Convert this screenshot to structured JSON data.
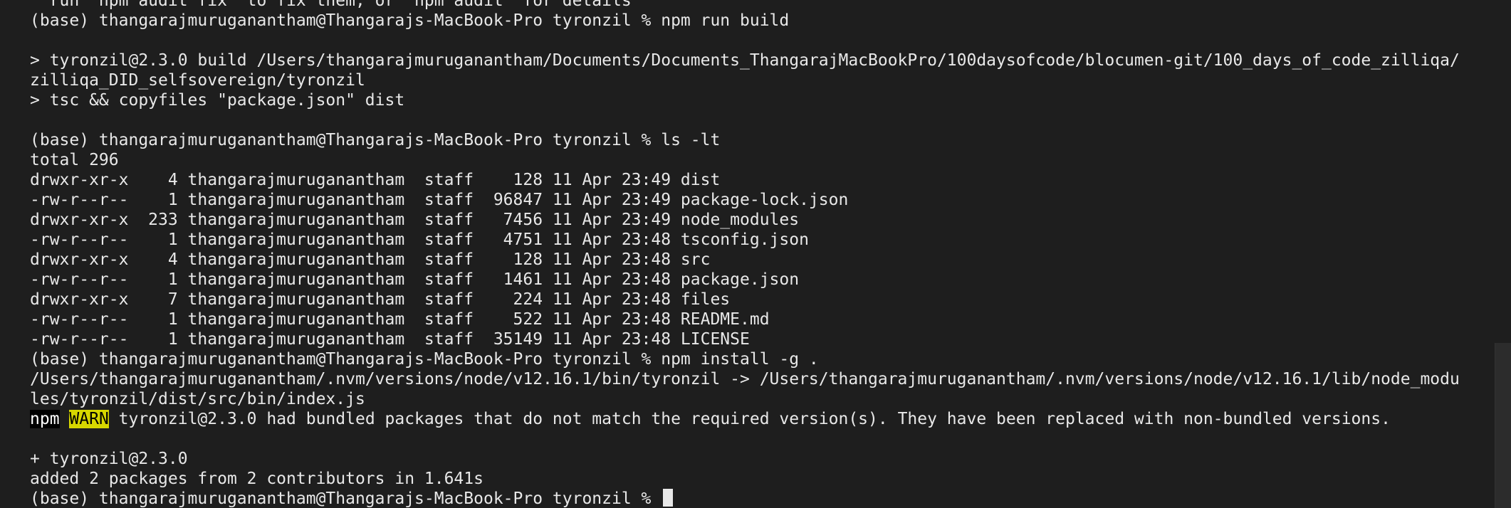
{
  "terminal": {
    "lines": [
      "  run `npm audit fix` to fix them, or `npm audit` for details",
      "(base) thangarajmuruganantham@Thangarajs-MacBook-Pro tyronzil % npm run build",
      "",
      "> tyronzil@2.3.0 build /Users/thangarajmuruganantham/Documents/Documents_ThangarajMacBookPro/100daysofcode/blocumen-git/100_days_of_code_zilliqa/",
      "zilliqa_DID_selfsovereign/tyronzil",
      "> tsc && copyfiles \"package.json\" dist",
      "",
      "(base) thangarajmuruganantham@Thangarajs-MacBook-Pro tyronzil % ls -lt",
      "total 296",
      "drwxr-xr-x    4 thangarajmuruganantham  staff    128 11 Apr 23:49 dist",
      "-rw-r--r--    1 thangarajmuruganantham  staff  96847 11 Apr 23:49 package-lock.json",
      "drwxr-xr-x  233 thangarajmuruganantham  staff   7456 11 Apr 23:49 node_modules",
      "-rw-r--r--    1 thangarajmuruganantham  staff   4751 11 Apr 23:48 tsconfig.json",
      "drwxr-xr-x    4 thangarajmuruganantham  staff    128 11 Apr 23:48 src",
      "-rw-r--r--    1 thangarajmuruganantham  staff   1461 11 Apr 23:48 package.json",
      "drwxr-xr-x    7 thangarajmuruganantham  staff    224 11 Apr 23:48 files",
      "-rw-r--r--    1 thangarajmuruganantham  staff    522 11 Apr 23:48 README.md",
      "-rw-r--r--    1 thangarajmuruganantham  staff  35149 11 Apr 23:48 LICENSE",
      "(base) thangarajmuruganantham@Thangarajs-MacBook-Pro tyronzil % npm install -g .",
      "/Users/thangarajmuruganantham/.nvm/versions/node/v12.16.1/bin/tyronzil -> /Users/thangarajmuruganantham/.nvm/versions/node/v12.16.1/lib/node_modu",
      "les/tyronzil/dist/src/bin/index.js"
    ],
    "warn_line": {
      "npm": "npm",
      "warn": "WARN",
      "message": " tyronzil@2.3.0 had bundled packages that do not match the required version(s). They have been replaced with non-bundled versions."
    },
    "tail_lines": [
      "",
      "+ tyronzil@2.3.0",
      "added 2 packages from 2 contributors in 1.641s"
    ],
    "prompt": "(base) thangarajmuruganantham@Thangarajs-MacBook-Pro tyronzil % "
  },
  "colors": {
    "background": "#1e1e1e",
    "text": "#e8e8e8",
    "warn_background": "#d7d700"
  }
}
